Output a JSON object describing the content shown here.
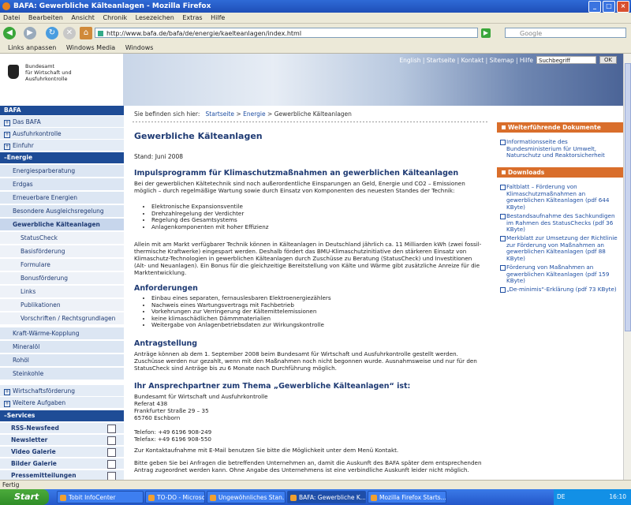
{
  "window": {
    "title": "BAFA: Gewerbliche Kälteanlagen - Mozilla Firefox"
  },
  "menu": [
    "Datei",
    "Bearbeiten",
    "Ansicht",
    "Chronik",
    "Lesezeichen",
    "Extras",
    "Hilfe"
  ],
  "nav": {
    "url": "http://www.bafa.de/bafa/de/energie/kaelteanlagen/index.html",
    "search_placeholder": "Google"
  },
  "bookmarks": [
    "Links anpassen",
    "Windows Media",
    "Windows"
  ],
  "header": {
    "logo_line1": "Bundesamt",
    "logo_line2": "für Wirtschaft und",
    "logo_line3": "Ausfuhrkontrolle",
    "top_links": "English | Startseite | Kontakt | Sitemap | Hilfe",
    "search_value": "Suchbegriff",
    "ok_label": "OK"
  },
  "sidebar": {
    "head": "BAFA",
    "top_items": [
      "Das BAFA",
      "Ausfuhrkontrolle",
      "Einfuhr"
    ],
    "category": "Energie",
    "energie_items": [
      "Energiesparberatung",
      "Erdgas",
      "Erneuerbare Energien",
      "Besondere Ausgleichsregelung"
    ],
    "active_item": "Gewerbliche Kälteanlagen",
    "sub_items": [
      "StatusCheck",
      "Basisförderung",
      "Formulare",
      "Bonusförderung",
      "Links",
      "Publikationen",
      "Vorschriften / Rechtsgrundlagen"
    ],
    "more_items": [
      "Kraft-Wärme-Kopplung",
      "Mineralöl",
      "Rohöl",
      "Steinkohle"
    ],
    "bottom_items": [
      "Wirtschaftsförderung",
      "Weitere Aufgaben"
    ],
    "services_head": "Services",
    "services": [
      "RSS-Newsfeed",
      "Newsletter",
      "Video Galerie",
      "Bilder Galerie",
      "Pressemitteilungen"
    ]
  },
  "main": {
    "breadcrumb_prefix": "Sie befinden sich hier:",
    "breadcrumb_1": "Startseite",
    "breadcrumb_2": "Energie",
    "breadcrumb_3": "Gewerbliche Kälteanlagen",
    "title": "Gewerbliche Kälteanlagen",
    "stand": "Stand: Juni 2008",
    "h_impuls": "Impulsprogramm für Klimaschutzmaßnahmen an gewerblichen Kälteanlagen",
    "p_impuls": "Bei der gewerblichen Kältetechnik sind noch außerordentliche Einsparungen an Geld, Energie und CO2 – Emissionen möglich – durch regelmäßige Wartung sowie durch Einsatz von Komponenten des neuesten Standes der Technik:",
    "list1": [
      "Elektronische Expansionsventile",
      "Drehzahlregelung der Verdichter",
      "Regelung des Gesamtsystems",
      "Anlagenkomponenten mit hoher Effizienz"
    ],
    "p_allein": "Allein mit am Markt verfügbarer Technik können in Kälteanlagen in Deutschland jährlich ca. 11 Milliarden kWh (zwei fossil-thermische Kraftwerke) eingespart werden. Deshalb fördert das BMU-Klimaschutzinitiative den stärkeren Einsatz von Klimaschutz-Technologien in gewerblichen Kälteanlagen durch Zuschüsse zu Beratung (StatusCheck) und Investitionen (Alt- und Neuanlagen). Ein Bonus für die gleichzeitige Bereitstellung von Kälte und Wärme gibt zusätzliche Anreize für die Marktentwicklung.",
    "h_anf": "Anforderungen",
    "list2": [
      "Einbau eines separaten, fernauslesbaren Elektroenergiezählers",
      "Nachweis eines Wartungsvertrags mit Fachbetrieb",
      "Vorkehrungen zur Verringerung der Kältemittelemissionen",
      "keine klimaschädlichen Dämmmaterialien",
      "Weitergabe von Anlagenbetriebsdaten zur Wirkungskontrolle"
    ],
    "h_antrag": "Antragstellung",
    "p_antrag": "Anträge können ab dem 1. September 2008 beim Bundesamt für Wirtschaft und Ausfuhrkontrolle gestellt werden. Zuschüsse werden nur gezahlt, wenn mit den Maßnahmen noch nicht begonnen wurde. Ausnahmsweise und nur für den StatusCheck sind Anträge bis zu 6 Monate nach Durchführung möglich.",
    "h_ansp": "Ihr Ansprechpartner zum Thema „Gewerbliche Kälteanlagen“ ist:",
    "addr1": "Bundesamt für Wirtschaft und Ausfuhrkontrolle",
    "addr2": "Referat 438",
    "addr3": "Frankfurter Straße 29 – 35",
    "addr4": "65760 Eschborn",
    "tel": "Telefon: +49 6196 908-249",
    "fax": "Telefax: +49 6196 908-550",
    "p_kontakt": "Zur Kontaktaufnahme mit E-Mail benutzen Sie bitte die Möglichkeit unter dem Menü Kontakt.",
    "p_bitte": "Bitte geben Sie bei Anfragen die betreffenden Unternehmen an, damit die Auskunft des BAFA später dem entsprechenden Antrag zugeordnet werden kann. Ohne Angabe des Unternehmens ist eine verbindliche Auskunft leider nicht möglich."
  },
  "right": {
    "head1": "Weiterführende Dokumente",
    "doc1": "Informationsseite des Bundesministerium für Umwelt, Naturschutz und Reaktorsicherheit",
    "head2": "Downloads",
    "downloads": [
      "Faltblatt – Förderung von Klimaschutzmaßnahmen an gewerblichen Kälteanlagen (pdf 644 KByte)",
      "Bestandsaufnahme des Sachkundigen im Rahmen des StatusChecks (pdf 36 KByte)",
      "Merkblatt zur Umsetzung der Richtlinie zur Förderung von Maßnahmen an gewerblichen Kälteanlagen (pdf 88 KByte)",
      "Förderung von Maßnahmen an gewerblichen Kälteanlagen (pdf 159 KByte)",
      "„De-minimis“-Erklärung (pdf 73 KByte)"
    ]
  },
  "status": "Fertig",
  "taskbar": {
    "start": "Start",
    "tasks": [
      "Tobit InfoCenter",
      "TO-DO - Microsoft Ou...",
      "Ungewöhnliches Stan...",
      "BAFA: Gewerbliche K...",
      "Mozilla Firefox Starts..."
    ],
    "lang": "DE",
    "clock": "16:10"
  }
}
